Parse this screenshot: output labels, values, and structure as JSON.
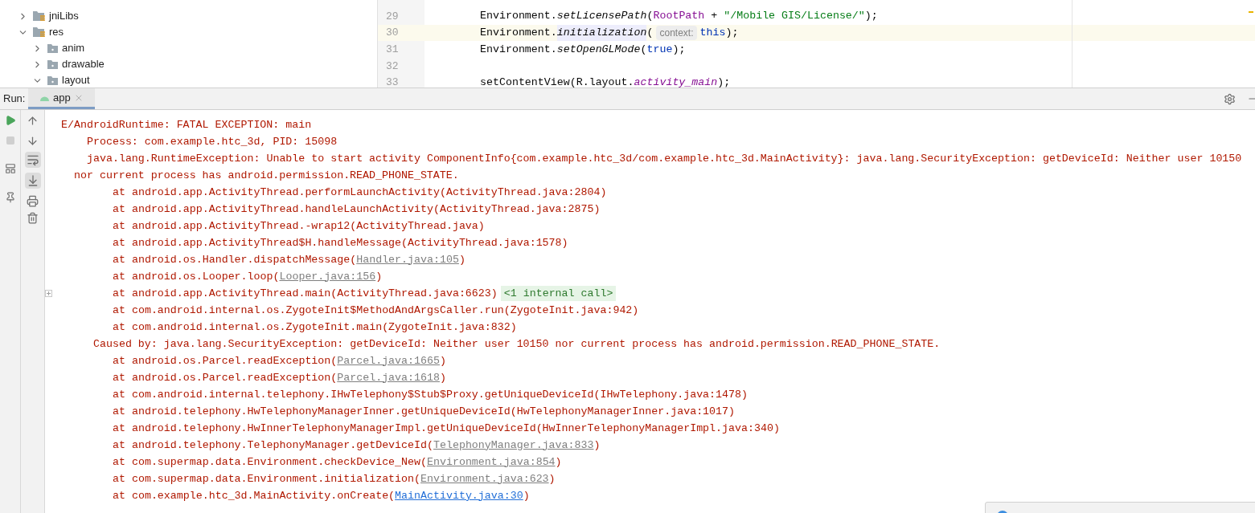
{
  "project_tree": [
    {
      "label": "jniLibs",
      "kind": "resources",
      "expanded": false
    },
    {
      "label": "res",
      "kind": "resources",
      "expanded": true,
      "children": [
        {
          "label": "anim",
          "kind": "plain",
          "expanded": false
        },
        {
          "label": "drawable",
          "kind": "plain",
          "expanded": false
        },
        {
          "label": "layout",
          "kind": "plain",
          "expanded": true
        }
      ]
    }
  ],
  "editor": {
    "lines": [
      {
        "number": "29",
        "current": false,
        "tokens": [
          {
            "kind": "plain",
            "text": "Environment."
          },
          {
            "kind": "method",
            "text": "setLicensePath"
          },
          {
            "kind": "plain",
            "text": "("
          },
          {
            "kind": "field",
            "text": "RootPath"
          },
          {
            "kind": "plain",
            "text": " + "
          },
          {
            "kind": "string",
            "text": "\"/Mobile GIS/License/\""
          },
          {
            "kind": "plain",
            "text": ");"
          }
        ]
      },
      {
        "number": "30",
        "current": true,
        "tokens": [
          {
            "kind": "plain",
            "text": "Environment."
          },
          {
            "kind": "method_highlight",
            "text": "initialization"
          },
          {
            "kind": "plain",
            "text": "("
          },
          {
            "kind": "hint",
            "text": "context:"
          },
          {
            "kind": "keyword",
            "text": "this"
          },
          {
            "kind": "plain",
            "text": ");"
          }
        ]
      },
      {
        "number": "31",
        "current": false,
        "tokens": [
          {
            "kind": "plain",
            "text": "Environment."
          },
          {
            "kind": "method",
            "text": "setOpenGLMode"
          },
          {
            "kind": "plain",
            "text": "("
          },
          {
            "kind": "keyword",
            "text": "true"
          },
          {
            "kind": "plain",
            "text": ");"
          }
        ]
      },
      {
        "number": "32",
        "current": false
      },
      {
        "number": "33",
        "current": false,
        "tokens": [
          {
            "kind": "plain",
            "text": "setContentView(R.layout."
          },
          {
            "kind": "field_italic",
            "text": "activity_main"
          },
          {
            "kind": "plain",
            "text": ");"
          }
        ]
      }
    ]
  },
  "run_panel": {
    "label": "Run:",
    "tabs": [
      {
        "label": "app",
        "selected": true
      }
    ]
  },
  "console": [
    {
      "kind": "header",
      "text": "E/AndroidRuntime: FATAL EXCEPTION: main"
    },
    {
      "kind": "message",
      "text": "Process: com.example.htc_3d, PID: 15098"
    },
    {
      "kind": "message",
      "text": "java.lang.RuntimeException: Unable to start activity ComponentInfo{com.example.htc_3d/com.example.htc_3d.MainActivity}: java.lang.SecurityException: getDeviceId: Neither user 10150"
    },
    {
      "kind": "continuation",
      "text": "nor current process has android.permission.READ_PHONE_STATE."
    },
    {
      "kind": "frame",
      "text": "at android.app.ActivityThread.performLaunchActivity(ActivityThread.java:2804)"
    },
    {
      "kind": "frame",
      "text": "at android.app.ActivityThread.handleLaunchActivity(ActivityThread.java:2875)"
    },
    {
      "kind": "frame",
      "text": "at android.app.ActivityThread.-wrap12(ActivityThread.java)"
    },
    {
      "kind": "frame",
      "text": "at android.app.ActivityThread$H.handleMessage(ActivityThread.java:1578)"
    },
    {
      "kind": "frame",
      "text": "at android.os.Handler.dispatchMessage(",
      "link": "Handler.java:105",
      "link_visited": true,
      "suffix": ")"
    },
    {
      "kind": "frame",
      "text": "at android.os.Looper.loop(",
      "link": "Looper.java:156",
      "link_visited": true,
      "suffix": ")"
    },
    {
      "kind": "frame",
      "text": "at android.app.ActivityThread.main(ActivityThread.java:6623)",
      "folded": "<1 internal call>"
    },
    {
      "kind": "frame",
      "text": "at com.android.internal.os.ZygoteInit$MethodAndArgsCaller.run(ZygoteInit.java:942)"
    },
    {
      "kind": "frame",
      "text": "at com.android.internal.os.ZygoteInit.main(ZygoteInit.java:832)"
    },
    {
      "kind": "caused_by",
      "text": "Caused by: java.lang.SecurityException: getDeviceId: Neither user 10150 nor current process has android.permission.READ_PHONE_STATE."
    },
    {
      "kind": "frame",
      "text": "at android.os.Parcel.readException(",
      "link": "Parcel.java:1665",
      "link_visited": true,
      "suffix": ")"
    },
    {
      "kind": "frame",
      "text": "at android.os.Parcel.readException(",
      "link": "Parcel.java:1618",
      "link_visited": true,
      "suffix": ")"
    },
    {
      "kind": "frame",
      "text": "at com.android.internal.telephony.IHwTelephony$Stub$Proxy.getUniqueDeviceId(IHwTelephony.java:1478)"
    },
    {
      "kind": "frame",
      "text": "at android.telephony.HwTelephonyManagerInner.getUniqueDeviceId(HwTelephonyManagerInner.java:1017)"
    },
    {
      "kind": "frame",
      "text": "at android.telephony.HwInnerTelephonyManagerImpl.getUniqueDeviceId(HwInnerTelephonyManagerImpl.java:340)"
    },
    {
      "kind": "frame",
      "text": "at android.telephony.TelephonyManager.getDeviceId(",
      "link": "TelephonyManager.java:833",
      "link_visited": true,
      "suffix": ")"
    },
    {
      "kind": "frame",
      "text": "at com.supermap.data.Environment.checkDevice_New(",
      "link": "Environment.java:854",
      "link_visited": true,
      "suffix": ")"
    },
    {
      "kind": "frame",
      "text": "at com.supermap.data.Environment.initialization(",
      "link": "Environment.java:623",
      "link_visited": true,
      "suffix": ")"
    },
    {
      "kind": "frame",
      "text": "at com.example.htc_3d.MainActivity.onCreate(",
      "link": "MainActivity.java:30",
      "link_visited": false,
      "suffix": ")"
    }
  ]
}
